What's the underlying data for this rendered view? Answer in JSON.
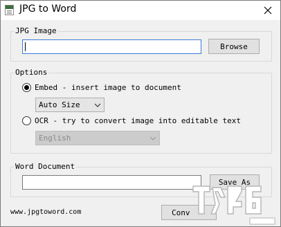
{
  "window": {
    "title": "JPG to Word"
  },
  "jpg_image": {
    "label": "JPG Image",
    "value": "",
    "browse_label": "Browse"
  },
  "options": {
    "label": "Options",
    "embed_label": "Embed - insert image to document",
    "embed_checked": true,
    "size_select": "Auto Size",
    "ocr_label": "OCR - try to convert image into editable text",
    "ocr_checked": false,
    "language_select": "English"
  },
  "word_document": {
    "label": "Word Document",
    "value": "",
    "save_as_label": "Save As"
  },
  "footer": {
    "website": "www.jpgtoword.com",
    "convert_label": "Conv"
  }
}
